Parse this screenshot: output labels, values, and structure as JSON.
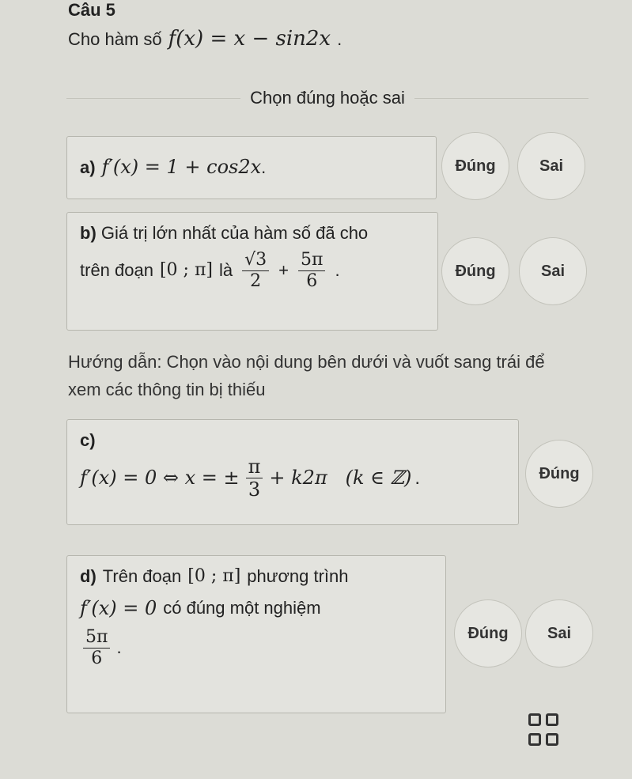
{
  "question": {
    "number": "Câu 5",
    "prefix": "Cho hàm số",
    "function_math": "f(x) = x − sin2x",
    "suffix": "."
  },
  "instruction": "Chọn đúng hoặc sai",
  "statements": [
    {
      "id": "a",
      "label": "a)",
      "math": "f′(x) = 1 + cos2x",
      "suffix": ".",
      "true_label": "Đúng",
      "false_label": "Sai"
    },
    {
      "id": "b",
      "label": "b)",
      "text_line1": "Giá trị lớn nhất của hàm số đã cho",
      "text_on": "trên đoạn",
      "interval": "[0 ; π]",
      "text_is": "là",
      "frac1_num": "√3",
      "frac1_den": "2",
      "plus": "+",
      "frac2_num": "5π",
      "frac2_den": "6",
      "suffix": ".",
      "true_label": "Đúng",
      "false_label": "Sai"
    },
    {
      "id": "c",
      "label": "c)",
      "math_left": "f′(x) = 0 ⇔ x = ±",
      "frac_num": "π",
      "frac_den": "3",
      "math_right": "+ k2π   (k ∈ ℤ)",
      "suffix": ".",
      "true_label": "Đúng"
    },
    {
      "id": "d",
      "label": "d)",
      "text_on": "Trên đoạn",
      "interval": "[0 ; π]",
      "text_eq": "phương trình",
      "math_eq": "f′(x) = 0",
      "text_has": "có đúng một nghiệm",
      "frac_num": "5π",
      "frac_den": "6",
      "suffix": ".",
      "true_label": "Đúng",
      "false_label": "Sai"
    }
  ],
  "hint": "Hướng dẫn: Chọn vào nội dung bên dưới và vuốt sang trái để xem các thông tin bị thiếu",
  "icons": {
    "grid": "grid-menu-icon"
  }
}
